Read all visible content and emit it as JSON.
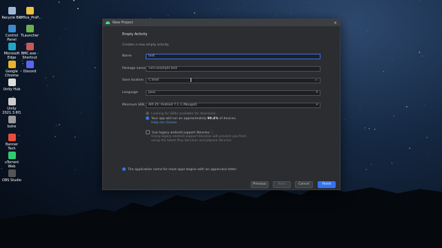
{
  "desktop": {
    "icons": [
      {
        "label": "Recycle Bin",
        "color": "#9fb8d8"
      },
      {
        "label": "Office_ProP...",
        "color": "#f0c040"
      },
      {
        "label": "Control Panel",
        "color": "#3c89d0"
      },
      {
        "label": "TLauncher",
        "color": "#6ab04c"
      },
      {
        "label": "Microsoft Edge",
        "color": "#1fa6c9"
      },
      {
        "label": "BMC.exe - Shortcut",
        "color": "#c85a5a"
      },
      {
        "label": "Google Chrome",
        "color": "#e8b32a"
      },
      {
        "label": "Discord",
        "color": "#5865f2"
      },
      {
        "label": "Unity Hub",
        "color": "#dddddd"
      },
      {
        "label": "Unity 2021.3.6f1",
        "color": "#cccccc"
      },
      {
        "label": "bolre",
        "color": "#9a9a9a"
      },
      {
        "label": "Banner Tech",
        "color": "#e74c3c"
      },
      {
        "label": "uTorrent Web",
        "color": "#2ecc71"
      },
      {
        "label": "OBS Studio",
        "color": "#555555"
      }
    ]
  },
  "dialog": {
    "title": "New Project",
    "close_glyph": "×",
    "heading": "Empty Activity",
    "subtitle": "Creates a new empty activity",
    "name_label": "Name",
    "name_value": "test",
    "package_label": "Package name",
    "package_value": "com.example.test",
    "save_label": "Save location",
    "save_value": "C:\\test",
    "language_label": "Language",
    "language_value": "Java",
    "minsdk_label": "Minimum SDK",
    "minsdk_value": "API 25: Android 7.1.1 (Nougat)",
    "sdk_searching": "Looking for SDKs available for download...",
    "sdk_run_prefix": "Your app will run on approximately ",
    "sdk_run_percent": "90.4%",
    "sdk_run_suffix": " of devices.",
    "help_link": "Help me choose",
    "legacy_label": "Use legacy android.support libraries",
    "legacy_note": "Using legacy android.support libraries will prevent you from using the latest Play Services and Jetpack libraries",
    "info_text": "The application name for most apps begins with an uppercase letter",
    "buttons": {
      "previous": "Previous",
      "next": "Next",
      "cancel": "Cancel",
      "finish": "Finish"
    },
    "accent": "#3574f0"
  }
}
